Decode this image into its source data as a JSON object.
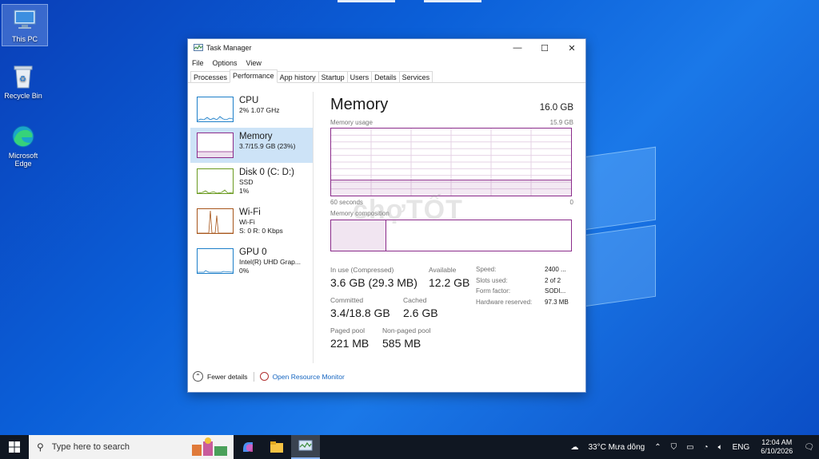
{
  "desktop": {
    "icons": [
      {
        "label": "This PC"
      },
      {
        "label": "Recycle Bin"
      },
      {
        "label": "Microsoft Edge"
      }
    ]
  },
  "window": {
    "title": "Task Manager",
    "menu": [
      "File",
      "Options",
      "View"
    ],
    "tabs": [
      "Processes",
      "Performance",
      "App history",
      "Startup",
      "Users",
      "Details",
      "Services"
    ],
    "active_tab": "Performance"
  },
  "sidebar": {
    "items": [
      {
        "name": "CPU",
        "line1": "2%  1.07 GHz",
        "line2": "",
        "color": "#1d7fc9"
      },
      {
        "name": "Memory",
        "line1": "3.7/15.9 GB (23%)",
        "line2": "",
        "color": "#8b2c8b"
      },
      {
        "name": "Disk 0 (C: D:)",
        "line1": "SSD",
        "line2": "1%",
        "color": "#6a9a1f"
      },
      {
        "name": "Wi-Fi",
        "line1": "Wi-Fi",
        "line2": "S: 0  R: 0 Kbps",
        "color": "#a7551a"
      },
      {
        "name": "GPU 0",
        "line1": "Intel(R) UHD Grap...",
        "line2": "0%",
        "color": "#1d7fc9"
      }
    ]
  },
  "memory": {
    "title": "Memory",
    "total": "16.0 GB",
    "usage_label": "Memory usage",
    "usage_max": "15.9 GB",
    "usage_level": 0.23,
    "time_left": "60 seconds",
    "time_right": "0",
    "composition_label": "Memory composition",
    "composition_in_use_fraction": 0.23,
    "stats": {
      "in_use_label": "In use (Compressed)",
      "in_use_value": "3.6 GB (29.3 MB)",
      "available_label": "Available",
      "available_value": "12.2 GB",
      "committed_label": "Committed",
      "committed_value": "3.4/18.8 GB",
      "cached_label": "Cached",
      "cached_value": "2.6 GB",
      "paged_label": "Paged pool",
      "paged_value": "221 MB",
      "nonpaged_label": "Non-paged pool",
      "nonpaged_value": "585 MB"
    },
    "details": [
      {
        "k": "Speed:",
        "v": "2400 ..."
      },
      {
        "k": "Slots used:",
        "v": "2 of 2"
      },
      {
        "k": "Form factor:",
        "v": "SODI..."
      },
      {
        "k": "Hardware reserved:",
        "v": "97.3 MB"
      }
    ]
  },
  "footer": {
    "fewer_details": "Fewer details",
    "resource_monitor": "Open Resource Monitor"
  },
  "watermark": "chợTỐT",
  "taskbar": {
    "search_placeholder": "Type here to search",
    "weather": "33°C  Mưa dông",
    "language": "ENG",
    "time": "12:04 AM",
    "date": "6/10/2026"
  }
}
